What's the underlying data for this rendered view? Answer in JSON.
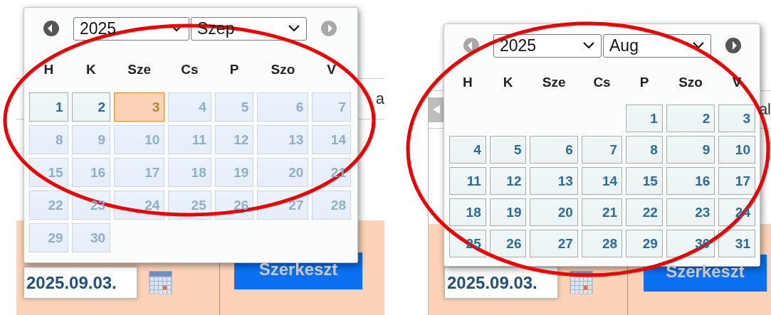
{
  "panels": [
    {
      "background": {
        "row_text": "a",
        "date_field": {
          "value": "2025.09.03."
        },
        "button": "Szerkeszt",
        "has_scroll_button": false
      },
      "datepicker": {
        "prev": {
          "disabled": false
        },
        "year": "2025",
        "month": "Szep",
        "next": {
          "disabled": true
        },
        "weekdays": [
          "H",
          "K",
          "Sze",
          "Cs",
          "P",
          "Szo",
          "V"
        ],
        "weeks": [
          [
            {
              "label": "1",
              "selected": false,
              "disabled": false
            },
            {
              "label": "2",
              "selected": false,
              "disabled": false
            },
            {
              "label": "3",
              "selected": true,
              "disabled": false
            },
            {
              "label": "4",
              "selected": false,
              "disabled": true
            },
            {
              "label": "5",
              "selected": false,
              "disabled": true
            },
            {
              "label": "6",
              "selected": false,
              "disabled": true
            },
            {
              "label": "7",
              "selected": false,
              "disabled": true
            }
          ],
          [
            {
              "label": "8",
              "selected": false,
              "disabled": true
            },
            {
              "label": "9",
              "selected": false,
              "disabled": true
            },
            {
              "label": "10",
              "selected": false,
              "disabled": true
            },
            {
              "label": "11",
              "selected": false,
              "disabled": true
            },
            {
              "label": "12",
              "selected": false,
              "disabled": true
            },
            {
              "label": "13",
              "selected": false,
              "disabled": true
            },
            {
              "label": "14",
              "selected": false,
              "disabled": true
            }
          ],
          [
            {
              "label": "15",
              "selected": false,
              "disabled": true
            },
            {
              "label": "16",
              "selected": false,
              "disabled": true
            },
            {
              "label": "17",
              "selected": false,
              "disabled": true
            },
            {
              "label": "18",
              "selected": false,
              "disabled": true
            },
            {
              "label": "19",
              "selected": false,
              "disabled": true
            },
            {
              "label": "20",
              "selected": false,
              "disabled": true
            },
            {
              "label": "21",
              "selected": false,
              "disabled": true
            }
          ],
          [
            {
              "label": "22",
              "selected": false,
              "disabled": true
            },
            {
              "label": "23",
              "selected": false,
              "disabled": true
            },
            {
              "label": "24",
              "selected": false,
              "disabled": true
            },
            {
              "label": "25",
              "selected": false,
              "disabled": true
            },
            {
              "label": "26",
              "selected": false,
              "disabled": true
            },
            {
              "label": "27",
              "selected": false,
              "disabled": true
            },
            {
              "label": "28",
              "selected": false,
              "disabled": true
            }
          ],
          [
            {
              "label": "29",
              "selected": false,
              "disabled": true
            },
            {
              "label": "30",
              "selected": false,
              "disabled": true
            }
          ]
        ]
      }
    },
    {
      "background": {
        "row_text": "al",
        "date_field": {
          "value": "2025.09.03."
        },
        "button": "Szerkeszt",
        "has_scroll_button": true
      },
      "datepicker": {
        "prev": {
          "disabled": true
        },
        "year": "2025",
        "month": "Aug",
        "next": {
          "disabled": false
        },
        "weekdays": [
          "H",
          "K",
          "Sze",
          "Cs",
          "P",
          "Szo",
          "V"
        ],
        "weeks": [
          [
            {
              "label": "1",
              "selected": false,
              "disabled": false
            },
            {
              "label": "2",
              "selected": false,
              "disabled": false
            },
            {
              "label": "3",
              "selected": false,
              "disabled": false
            }
          ],
          [
            {
              "label": "4",
              "selected": false,
              "disabled": false
            },
            {
              "label": "5",
              "selected": false,
              "disabled": false
            },
            {
              "label": "6",
              "selected": false,
              "disabled": false
            },
            {
              "label": "7",
              "selected": false,
              "disabled": false
            },
            {
              "label": "8",
              "selected": false,
              "disabled": false
            },
            {
              "label": "9",
              "selected": false,
              "disabled": false
            },
            {
              "label": "10",
              "selected": false,
              "disabled": false
            }
          ],
          [
            {
              "label": "11",
              "selected": false,
              "disabled": false
            },
            {
              "label": "12",
              "selected": false,
              "disabled": false
            },
            {
              "label": "13",
              "selected": false,
              "disabled": false
            },
            {
              "label": "14",
              "selected": false,
              "disabled": false
            },
            {
              "label": "15",
              "selected": false,
              "disabled": false
            },
            {
              "label": "16",
              "selected": false,
              "disabled": false
            },
            {
              "label": "17",
              "selected": false,
              "disabled": false
            }
          ],
          [
            {
              "label": "18",
              "selected": false,
              "disabled": false
            },
            {
              "label": "19",
              "selected": false,
              "disabled": false
            },
            {
              "label": "20",
              "selected": false,
              "disabled": false
            },
            {
              "label": "21",
              "selected": false,
              "disabled": false
            },
            {
              "label": "22",
              "selected": false,
              "disabled": false
            },
            {
              "label": "23",
              "selected": false,
              "disabled": false
            },
            {
              "label": "24",
              "selected": false,
              "disabled": false
            }
          ],
          [
            {
              "label": "25",
              "selected": false,
              "disabled": false
            },
            {
              "label": "26",
              "selected": false,
              "disabled": false
            },
            {
              "label": "27",
              "selected": false,
              "disabled": false
            },
            {
              "label": "28",
              "selected": false,
              "disabled": false
            },
            {
              "label": "29",
              "selected": false,
              "disabled": false
            },
            {
              "label": "30",
              "selected": false,
              "disabled": false
            },
            {
              "label": "31",
              "selected": false,
              "disabled": false
            }
          ]
        ]
      }
    }
  ]
}
